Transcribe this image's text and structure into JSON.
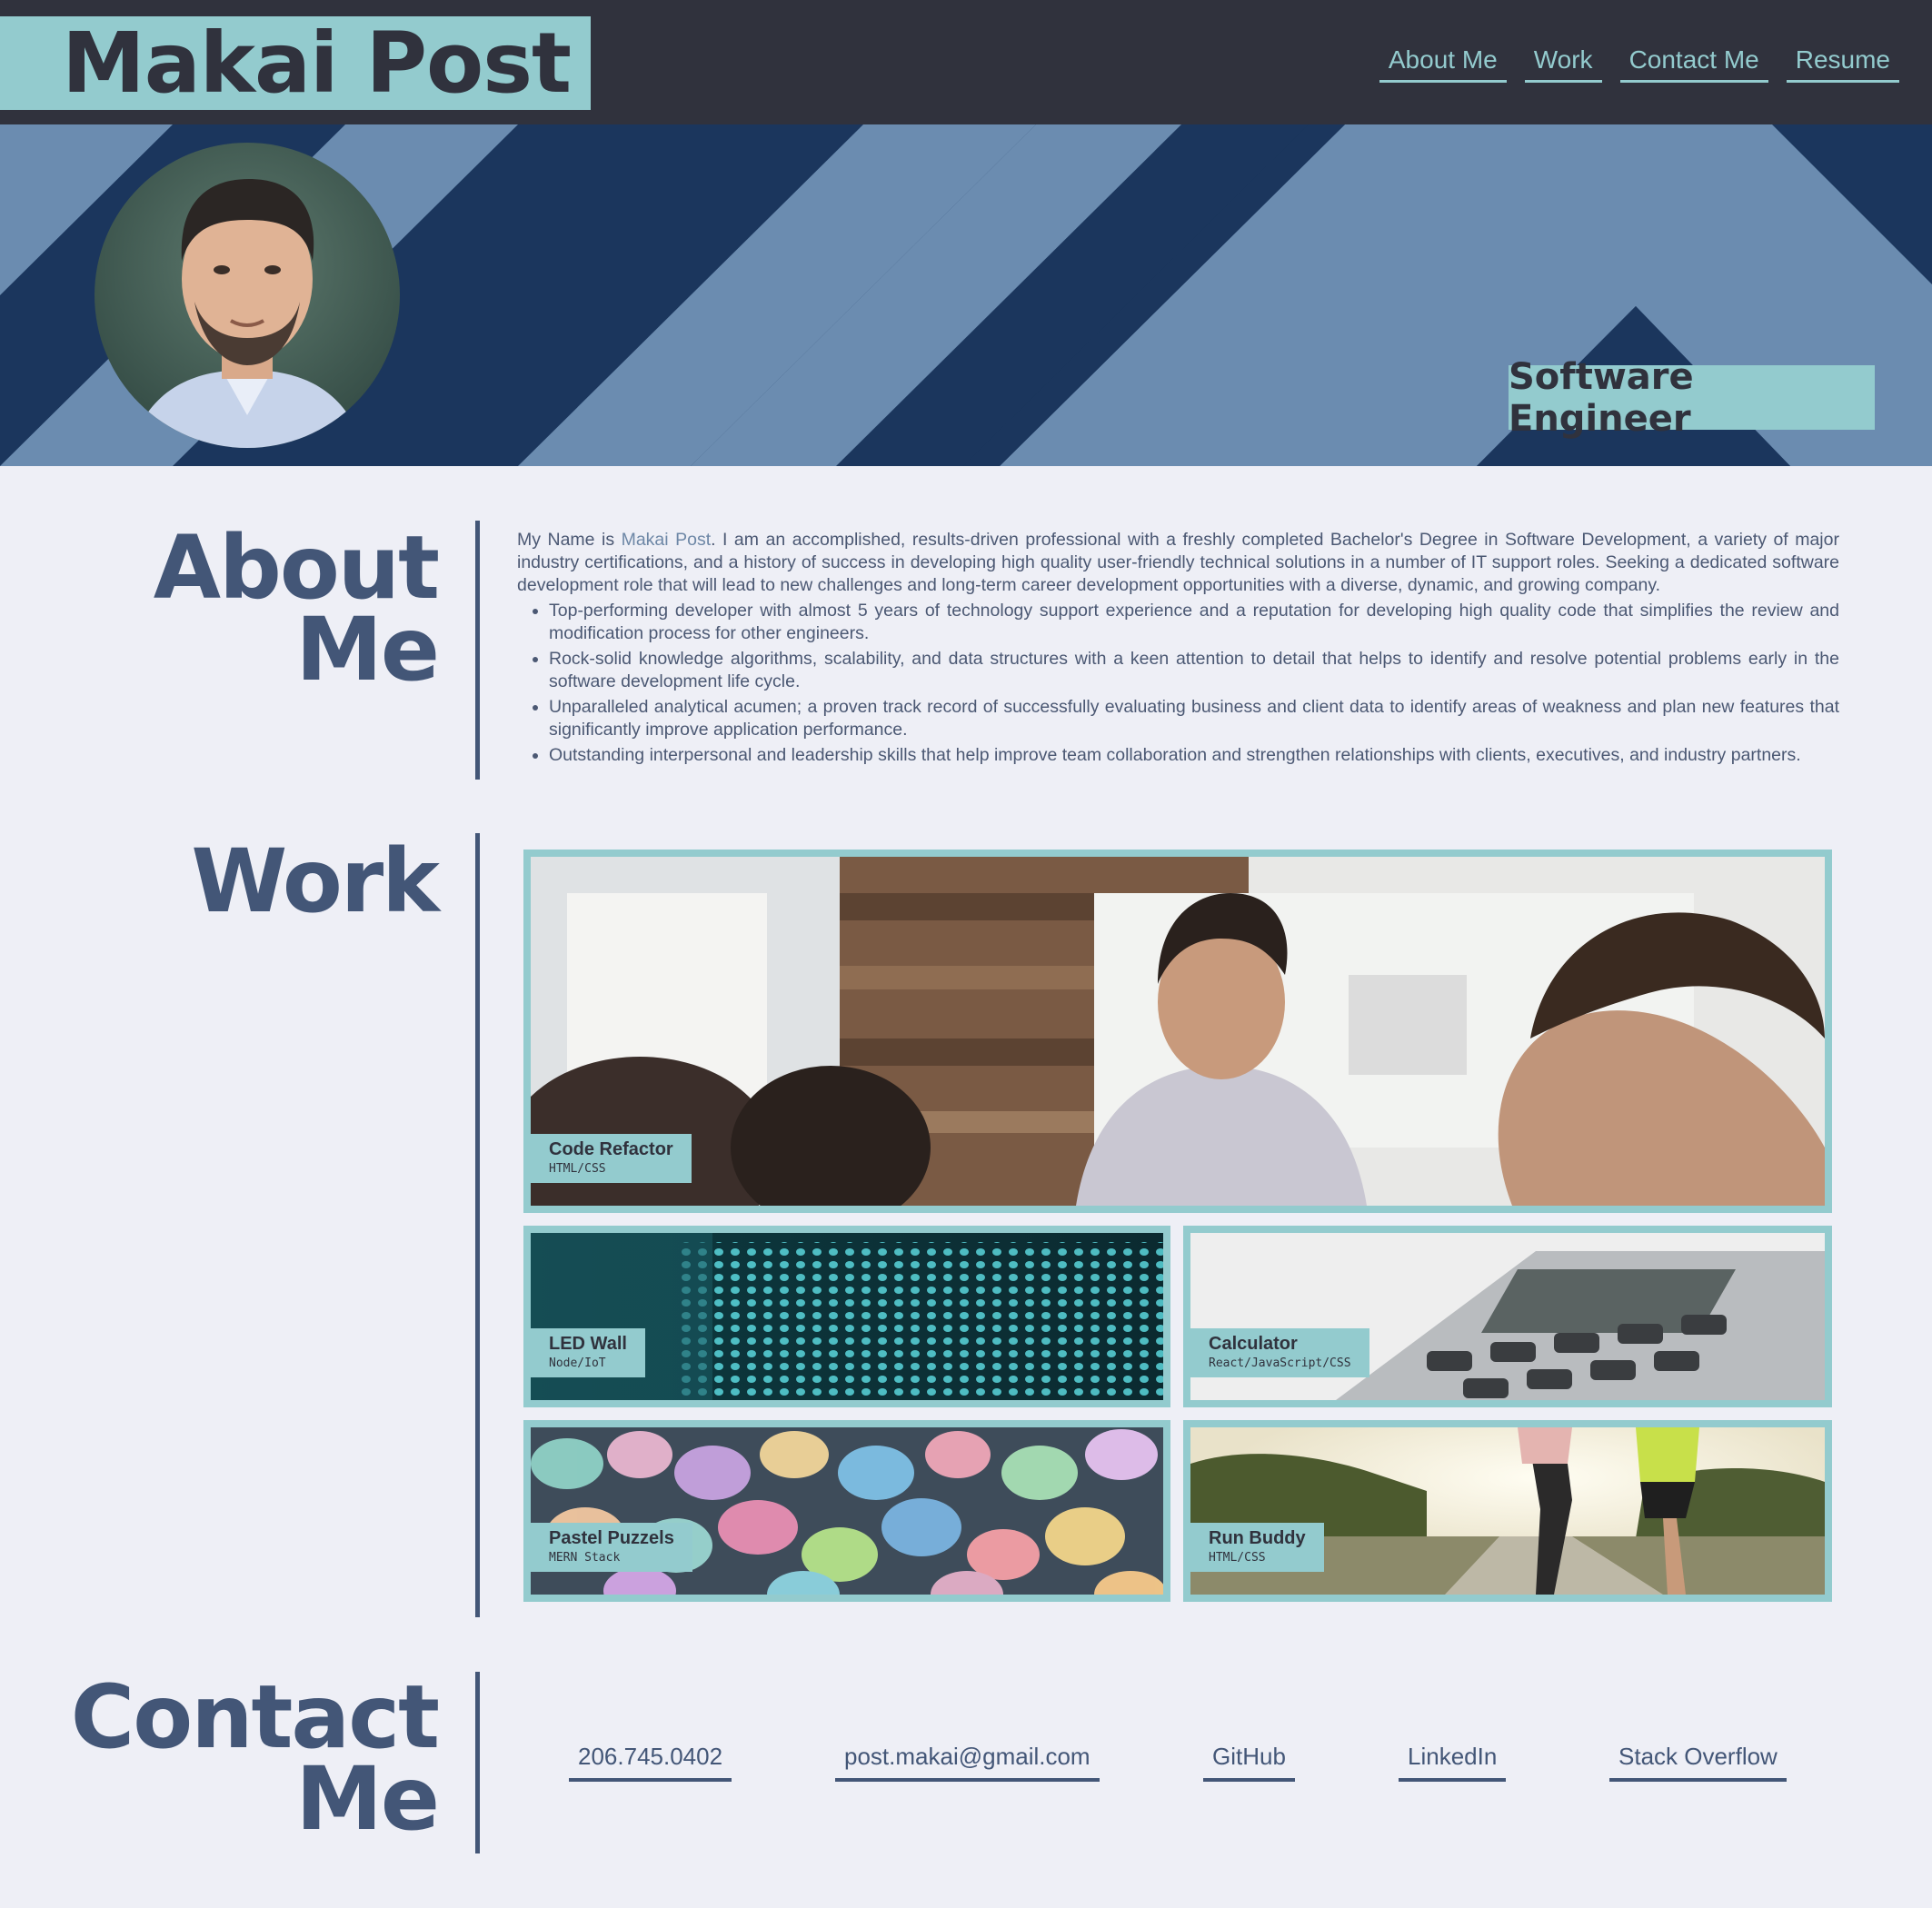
{
  "header": {
    "brand": "Makai Post",
    "nav": [
      "About Me",
      "Work",
      "Contact Me",
      "Resume"
    ]
  },
  "hero": {
    "job_title": "Software Engineer"
  },
  "about": {
    "title_line1": "About",
    "title_line2": "Me",
    "intro_prefix": "My Name is ",
    "intro_name": "Makai Post",
    "intro_rest": ". I am an accomplished, results-driven professional with a freshly completed Bachelor's Degree in Software Development, a variety of major industry certifications, and a history of success in developing high quality user-friendly technical solutions in a number of IT support roles. Seeking a dedicated software development role that will lead to new challenges and long-term career development opportunities with a diverse, dynamic, and growing company.",
    "bullets": [
      "Top-performing developer with almost 5 years of technology support experience and a reputation for developing high quality code that simplifies the review and modification process for other engineers.",
      "Rock-solid knowledge algorithms, scalability, and data structures with a keen attention to detail that helps to identify and resolve potential problems early in the software development life cycle.",
      "Unparalleled analytical acumen; a proven track record of successfully evaluating business and client data to identify areas of weakness and plan new features that significantly improve application performance.",
      "Outstanding interpersonal and leadership skills that help improve team collaboration and strengthen relationships with clients, executives, and industry partners."
    ]
  },
  "work": {
    "title": "Work",
    "projects": [
      {
        "name": "Code Refactor",
        "tech": "HTML/CSS"
      },
      {
        "name": "LED Wall",
        "tech": "Node/IoT"
      },
      {
        "name": "Calculator",
        "tech": "React/JavaScript/CSS"
      },
      {
        "name": "Pastel Puzzels",
        "tech": "MERN Stack"
      },
      {
        "name": "Run Buddy",
        "tech": "HTML/CSS"
      }
    ]
  },
  "contact": {
    "title_line1": "Contact",
    "title_line2": "Me",
    "links": [
      "206.745.0402",
      "post.makai@gmail.com",
      "GitHub",
      "LinkedIn",
      "Stack Overflow"
    ]
  },
  "colors": {
    "header_bg": "#30323d",
    "accent": "#93cbce",
    "hero_dark": "#1b365d",
    "hero_light": "#6b8cb0",
    "heading": "#435677",
    "page_bg": "#eeeff6"
  }
}
